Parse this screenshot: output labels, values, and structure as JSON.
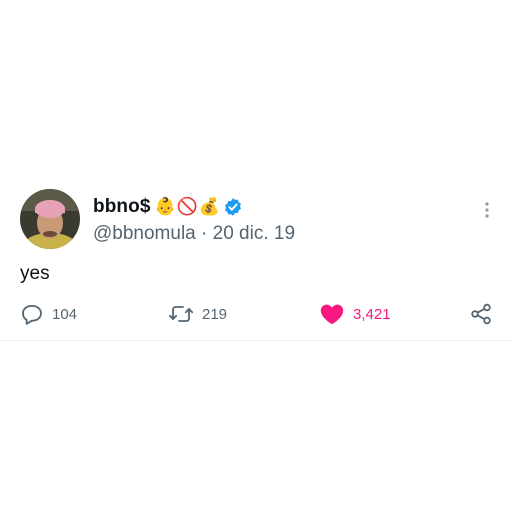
{
  "tweet": {
    "display_name": "bbno$",
    "name_emojis": [
      "👶",
      "🚫",
      "💰"
    ],
    "verified": true,
    "handle": "@bbnomula",
    "separator": "·",
    "date": "20 dic. 19",
    "text": "yes"
  },
  "actions": {
    "replies": "104",
    "retweets": "219",
    "likes": "3,421",
    "liked": true
  },
  "colors": {
    "text": "#0f1419",
    "muted": "#536471",
    "like": "#f91880",
    "verified": "#1d9bf0"
  },
  "icons": {
    "reply": "speech-bubble-icon",
    "retweet": "retweet-icon",
    "like": "heart-filled-icon",
    "share": "share-icon",
    "more": "more-vertical-icon",
    "verified": "verified-badge-icon"
  }
}
